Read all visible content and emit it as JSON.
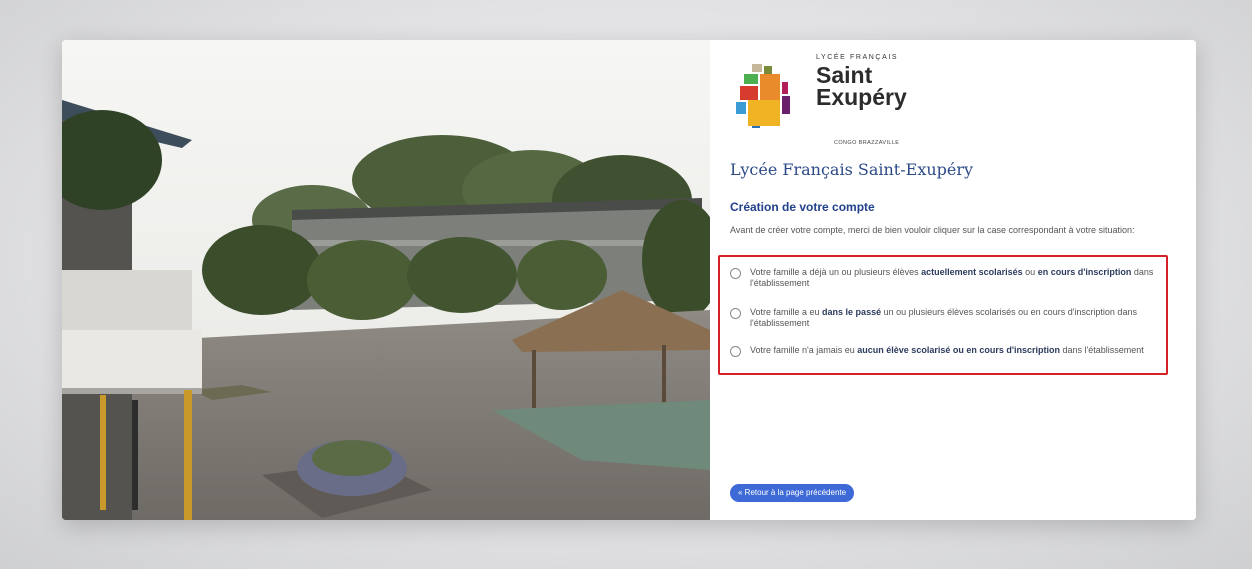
{
  "logo": {
    "small_caps": "LYCÉE FRANÇAIS",
    "title_line1": "Saint",
    "title_line2": "Exupéry",
    "subtitle": "CONGO BRAZZAVILLE"
  },
  "school_title": "Lycée Français Saint-Exupéry",
  "section_title": "Création de votre compte",
  "intro": "Avant de créer votre compte, merci de bien vouloir cliquer sur la case correspondant à votre situation:",
  "options": [
    {
      "pre": "Votre famille a déjà un ou plusieurs élèves ",
      "bold1": "actuellement scolarisés",
      "mid": " ou ",
      "bold2": "en cours d'inscription",
      "post": " dans l'établissement"
    },
    {
      "pre": "Votre famille a eu ",
      "bold1": "dans le passé",
      "post": " un ou plusieurs élèves scolarisés ou en cours d'inscription dans l'établissement"
    },
    {
      "pre": "Votre famille n'a jamais eu ",
      "bold1": "aucun élève scolarisé ou en cours d'inscription",
      "post": " dans l'établissement"
    }
  ],
  "back_button": "« Retour à la page précédente",
  "colors": {
    "accent_blue": "#2b4a87",
    "button_blue": "#3d6ad6",
    "highlight_red": "#d62027"
  }
}
